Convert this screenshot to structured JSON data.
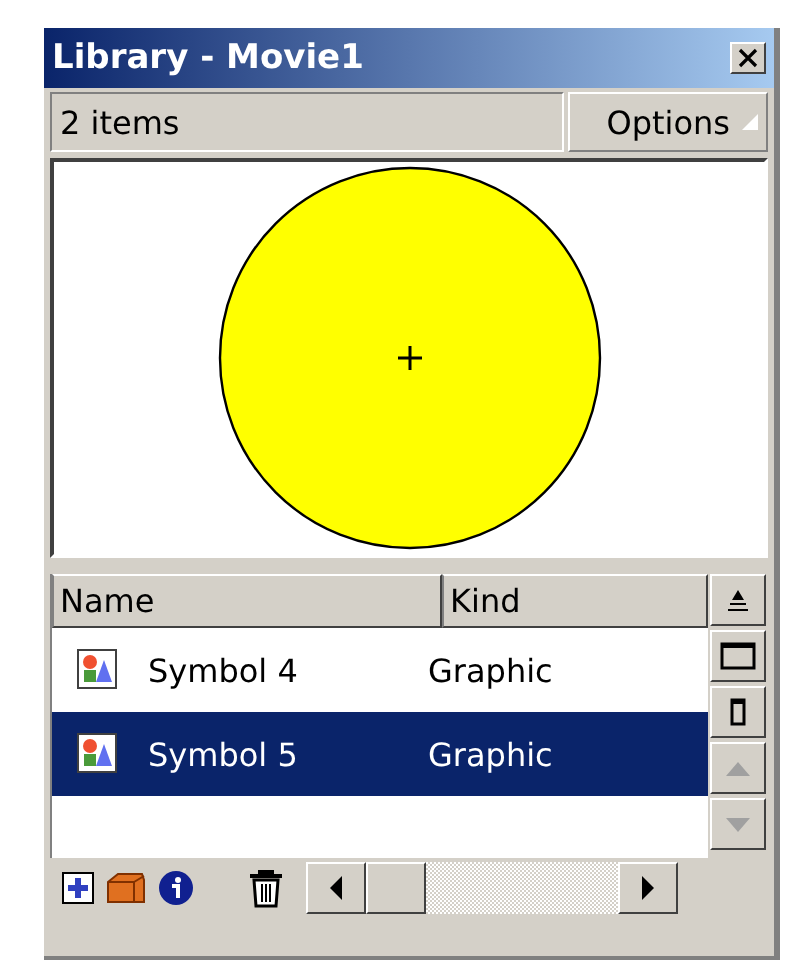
{
  "window": {
    "title": "Library - Movie1"
  },
  "toolbar": {
    "count": "2 items",
    "options": "Options"
  },
  "preview": {
    "kind": "circle"
  },
  "table": {
    "columns": [
      "Name",
      "Kind"
    ],
    "rows": [
      {
        "name": "Symbol 4",
        "kind": "Graphic",
        "selected": false
      },
      {
        "name": "Symbol 5",
        "kind": "Graphic",
        "selected": true
      }
    ]
  }
}
